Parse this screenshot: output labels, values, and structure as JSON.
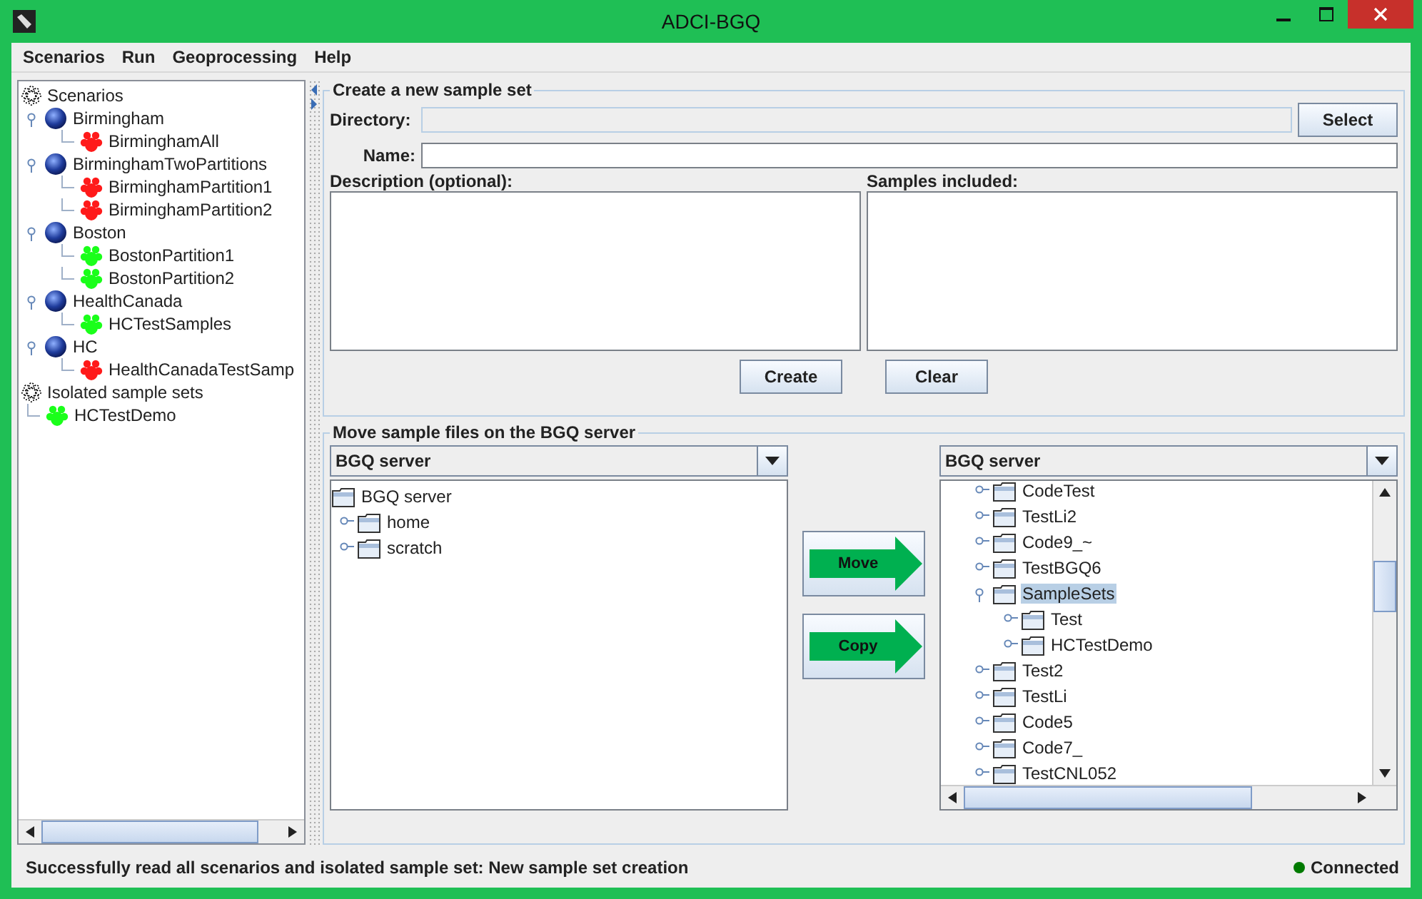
{
  "window": {
    "title": "ADCI-BGQ"
  },
  "menu": [
    "Scenarios",
    "Run",
    "Geoprocessing",
    "Help"
  ],
  "scenario_tree": [
    {
      "label": "Scenarios",
      "kind": "root",
      "children": [
        {
          "label": "Birmingham",
          "kind": "scenario",
          "expanded": true,
          "children": [
            {
              "label": "BirminghamAll",
              "kind": "sample",
              "color": "#ff1a1a"
            }
          ]
        },
        {
          "label": "BirminghamTwoPartitions",
          "kind": "scenario",
          "expanded": true,
          "children": [
            {
              "label": "BirminghamPartition1",
              "kind": "sample",
              "color": "#ff1a1a"
            },
            {
              "label": "BirminghamPartition2",
              "kind": "sample",
              "color": "#ff1a1a"
            }
          ]
        },
        {
          "label": "Boston",
          "kind": "scenario",
          "expanded": true,
          "children": [
            {
              "label": "BostonPartition1",
              "kind": "sample",
              "color": "#1aff1a"
            },
            {
              "label": "BostonPartition2",
              "kind": "sample",
              "color": "#1aff1a"
            }
          ]
        },
        {
          "label": "HealthCanada",
          "kind": "scenario",
          "expanded": true,
          "children": [
            {
              "label": "HCTestSamples",
              "kind": "sample",
              "color": "#1aff1a"
            }
          ]
        },
        {
          "label": "HC",
          "kind": "scenario",
          "expanded": true,
          "children": [
            {
              "label": "HealthCanadaTestSamp",
              "kind": "sample",
              "color": "#ff1a1a"
            }
          ]
        }
      ]
    },
    {
      "label": "Isolated sample sets",
      "kind": "root",
      "children": [
        {
          "label": "HCTestDemo",
          "kind": "sample",
          "color": "#1aff1a"
        }
      ]
    }
  ],
  "create_panel": {
    "title": "Create a new sample set",
    "fields": [
      {
        "label": "Directory:",
        "disabled": true,
        "button": "Select"
      },
      {
        "label": "Name:",
        "disabled": false
      }
    ],
    "description_label": "Description (optional):",
    "samples_label": "Samples included:",
    "buttons": [
      "Create",
      "Clear"
    ]
  },
  "move_panel": {
    "title": "Move sample files on the BGQ server",
    "left": {
      "combo": "BGQ server",
      "tree": [
        {
          "label": "BGQ server",
          "selected": false,
          "children": [
            {
              "label": "home",
              "expanded": false,
              "selected": false
            },
            {
              "label": "scratch",
              "expanded": false,
              "selected": false
            }
          ]
        }
      ]
    },
    "actions": [
      "Move",
      "Copy"
    ],
    "right": {
      "combo": "BGQ server",
      "tree": [
        {
          "label": "CodeTest",
          "expanded": false,
          "selected": false
        },
        {
          "label": "TestLi2",
          "expanded": false,
          "selected": false
        },
        {
          "label": "Code9_~",
          "expanded": false,
          "selected": false
        },
        {
          "label": "TestBGQ6",
          "expanded": false,
          "selected": false
        },
        {
          "label": "SampleSets",
          "expanded": true,
          "selected": true,
          "children": [
            {
              "label": "Test",
              "expanded": false,
              "selected": false
            },
            {
              "label": "HCTestDemo",
              "expanded": false,
              "selected": false
            }
          ]
        },
        {
          "label": "Test2",
          "expanded": false,
          "selected": false
        },
        {
          "label": "TestLi",
          "expanded": false,
          "selected": false
        },
        {
          "label": "Code5",
          "expanded": false,
          "selected": false
        },
        {
          "label": "Code7_",
          "expanded": false,
          "selected": false
        },
        {
          "label": "TestCNL052",
          "expanded": false,
          "selected": false
        }
      ]
    }
  },
  "status_bar": {
    "message": "Successfully read all scenarios and isolated sample set: New sample set creation",
    "connection": "Connected",
    "connected": true
  }
}
